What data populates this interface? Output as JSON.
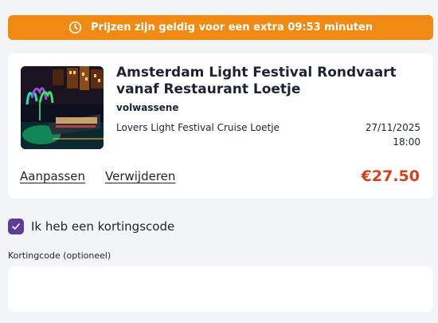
{
  "banner": {
    "text": "Prijzen zijn geldig voor een extra 09:53 minuten",
    "icon": "clock-icon"
  },
  "cart_item": {
    "title": "Amsterdam Light Festival Rondvaart vanaf Restaurant Loetje",
    "audience": "volwassene",
    "option": "Lovers Light Festival Cruise Loetje",
    "date": "27/11/2025",
    "time": "18:00",
    "edit_label": "Aanpassen",
    "remove_label": "Verwijderen",
    "price": "€27.50"
  },
  "discount": {
    "toggle_label": "Ik heb een kortingscode",
    "checked": true,
    "field_label": "Kortingcode (optioneel)",
    "field_value": ""
  },
  "colors": {
    "banner": "#f18a12",
    "price": "#d2421a",
    "checkbox": "#5d3d99"
  }
}
